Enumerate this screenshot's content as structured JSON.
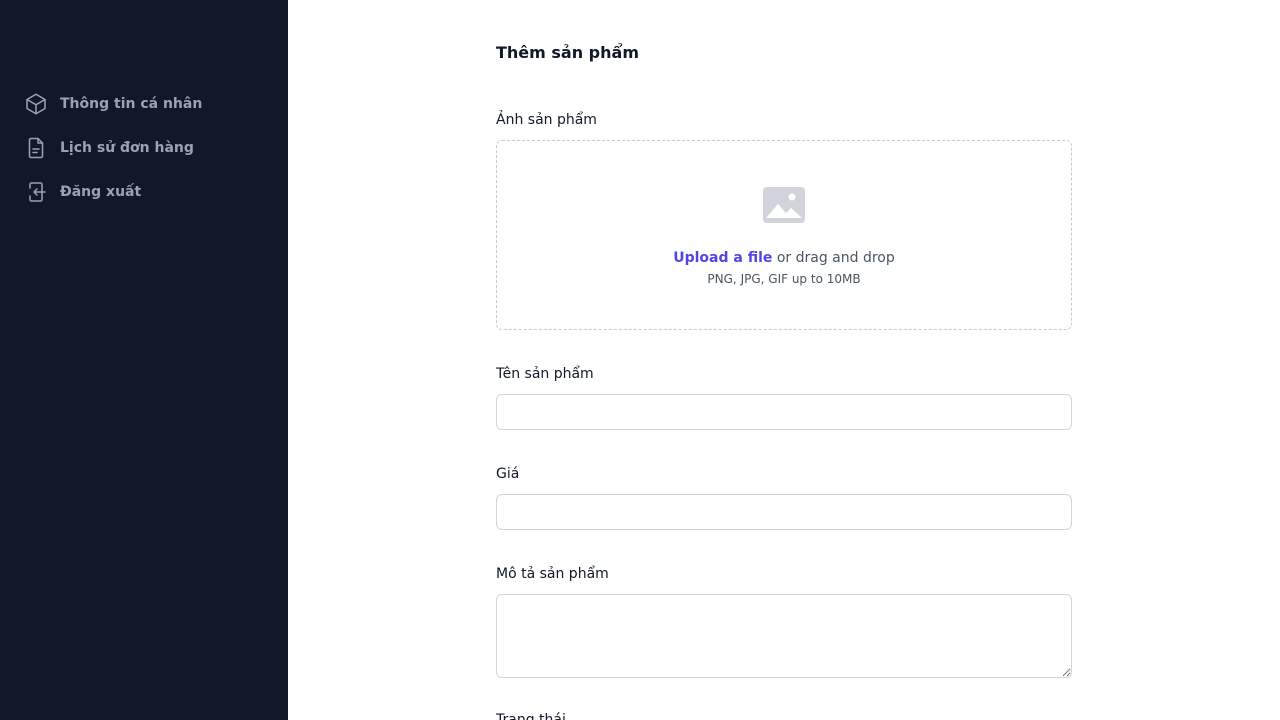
{
  "sidebar": {
    "items": [
      {
        "label": "Thông tin cá nhân",
        "icon": "cube-icon"
      },
      {
        "label": "Lịch sử đơn hàng",
        "icon": "document-icon"
      },
      {
        "label": "Đăng xuất",
        "icon": "logout-icon"
      }
    ]
  },
  "form": {
    "title": "Thêm sản phẩm",
    "image_label": "Ảnh sản phẩm",
    "upload_link": "Upload a file",
    "upload_suffix": " or drag and drop",
    "upload_hint": "PNG, JPG, GIF up to 10MB",
    "name_label": "Tên sản phẩm",
    "name_value": "",
    "price_label": "Giá",
    "price_value": "",
    "description_label": "Mô tả sản phẩm",
    "description_value": "",
    "status_label": "Trạng thái"
  },
  "colors": {
    "sidebar_bg": "#111827",
    "sidebar_text": "#9ca3af",
    "accent": "#4f46e5",
    "border": "#d1d5db"
  }
}
